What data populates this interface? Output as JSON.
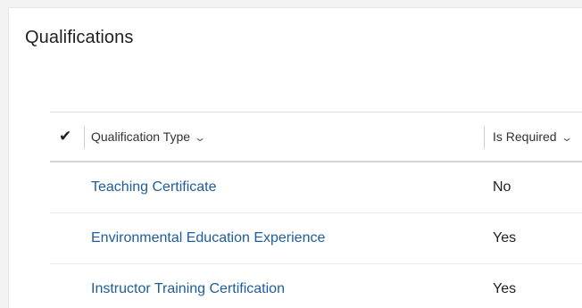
{
  "section": {
    "title": "Qualifications"
  },
  "grid": {
    "columns": {
      "type": "Qualification Type",
      "required": "Is Required"
    },
    "rows": [
      {
        "type": "Teaching Certificate",
        "required": "No"
      },
      {
        "type": "Environmental Education Experience",
        "required": "Yes"
      },
      {
        "type": "Instructor Training Certification",
        "required": "Yes"
      }
    ]
  },
  "colors": {
    "link": "#1d5d9b",
    "text": "#201f1e"
  }
}
